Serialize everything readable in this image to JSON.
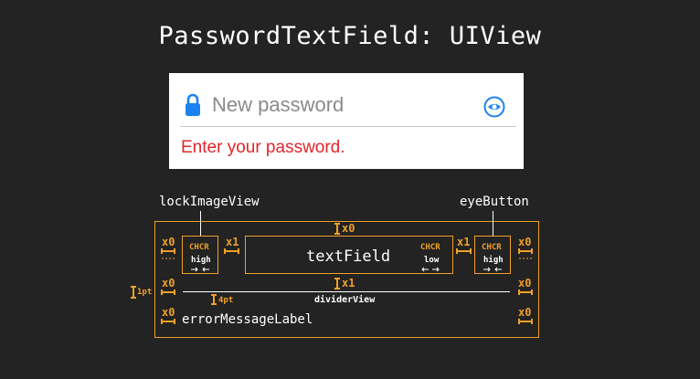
{
  "title": "PasswordTextField: UIView",
  "preview": {
    "placeholder": "New password",
    "error_message": "Enter your password.",
    "icons": {
      "lock": "lock-icon",
      "eye": "eye-icon"
    },
    "colors": {
      "accent": "#1a82f0",
      "error": "#e0262a",
      "placeholder": "#8a8a8e"
    }
  },
  "diagram": {
    "labels": {
      "lock_image_view": "lockImageView",
      "eye_button": "eyeButton",
      "text_field": "textField",
      "divider_view": "dividerView",
      "error_message_label": "errorMessageLabel"
    },
    "chcr": "CHCR",
    "priority_high": "high",
    "priority_low": "low",
    "spacing": {
      "x0": "x0",
      "x1": "x1",
      "one_pt": "1pt",
      "four_pt": "4pt"
    },
    "colors": {
      "constraint": "#f0a028",
      "line": "#ffffff"
    }
  }
}
